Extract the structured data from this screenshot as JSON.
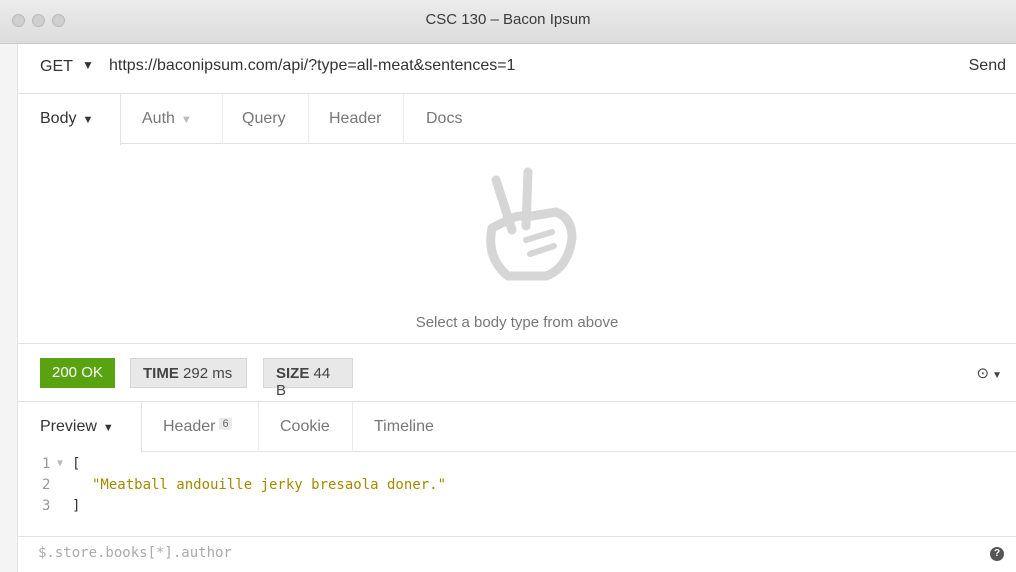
{
  "window": {
    "title": "CSC 130 – Bacon Ipsum"
  },
  "request": {
    "method": "GET",
    "url": "https://baconipsum.com/api/?type=all-meat&sentences=1",
    "send_label": "Send",
    "tabs": [
      {
        "label": "Body",
        "active": true
      },
      {
        "label": "Auth"
      },
      {
        "label": "Query"
      },
      {
        "label": "Header"
      },
      {
        "label": "Docs"
      }
    ],
    "body_hint": "Select a body type from above",
    "empty_icon": "peace-hand-icon"
  },
  "response": {
    "status": "200 OK",
    "time_label": "TIME",
    "time_value": "292 ms",
    "size_label": "SIZE",
    "size_value": "44 B",
    "history_icon": "clock-icon",
    "tabs": [
      {
        "label": "Preview",
        "active": true
      },
      {
        "label": "Header",
        "count": "6"
      },
      {
        "label": "Cookie"
      },
      {
        "label": "Timeline"
      }
    ],
    "code_lines": [
      {
        "num": "1",
        "text": "["
      },
      {
        "num": "2",
        "text": "\"Meatball andouille jerky bresaola doner.\""
      },
      {
        "num": "3",
        "text": "]"
      }
    ],
    "filter_placeholder": "$.store.books[*].author"
  },
  "colors": {
    "status_ok": "#59a210",
    "json_string": "#a48900"
  }
}
